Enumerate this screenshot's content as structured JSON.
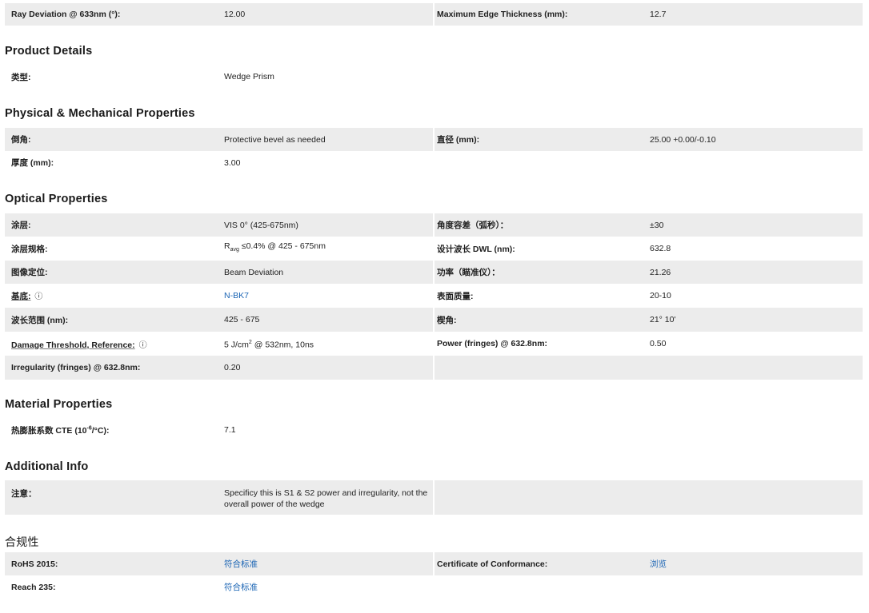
{
  "top_row": {
    "label1": "Ray Deviation @ 633nm (°):",
    "value1": "12.00",
    "label2": "Maximum Edge Thickness (mm):",
    "value2": "12.7"
  },
  "product_details": {
    "heading": "Product Details",
    "type_label": "类型:",
    "type_value": "Wedge Prism"
  },
  "physical": {
    "heading": "Physical & Mechanical Properties",
    "bevel_label": "倒角:",
    "bevel_value": "Protective bevel as needed",
    "diameter_label": "直径 (mm):",
    "diameter_value": "25.00 +0.00/-0.10",
    "thickness_label": "厚度 (mm):",
    "thickness_value": "3.00"
  },
  "optical": {
    "heading": "Optical Properties",
    "coating_label": "涂层:",
    "coating_value": "VIS 0° (425-675nm)",
    "angle_tol_label": "角度容差（弧秒）：",
    "angle_tol_value": "±30",
    "coating_spec_label": "涂层规格:",
    "coating_spec_r": "R",
    "coating_spec_sub": "avg",
    "coating_spec_rest": " ≤0.4% @ 425 - 675nm",
    "design_wl_label": "设计波长 DWL (nm):",
    "design_wl_value": "632.8",
    "image_label": "图像定位:",
    "image_value": "Beam Deviation",
    "power_label": "功率（瞄准仪）：",
    "power_value": "21.26",
    "substrate_label": "基底:",
    "substrate_icon": "ⓘ",
    "substrate_value": "N-BK7",
    "surface_label": "表面质量:",
    "surface_value": "20-10",
    "wavelength_label": "波长范围 (nm):",
    "wavelength_value": "425 - 675",
    "wedge_label": "楔角:",
    "wedge_value": "21° 10'",
    "damage_label": "Damage Threshold, Reference:",
    "damage_icon": "ⓘ",
    "damage_value_pre": "5 J/cm",
    "damage_value_sup": "2",
    "damage_value_post": " @ 532nm, 10ns",
    "power_fringes_label": "Power (fringes) @ 632.8nm:",
    "power_fringes_value": "0.50",
    "irregularity_label": "Irregularity (fringes) @ 632.8nm:",
    "irregularity_value": "0.20"
  },
  "material": {
    "heading": "Material Properties",
    "cte_label_pre": "热膨胀系数 CTE (10",
    "cte_label_sup": "-6",
    "cte_label_post": "/°C):",
    "cte_value": "7.1"
  },
  "additional": {
    "heading": "Additional Info",
    "note_label": "注意：",
    "note_line1": "Specificy this is S1 & S2 power and irregularity, not the",
    "note_line2": "overall power of the wedge"
  },
  "compliance": {
    "heading": "合规性",
    "rohs_label": "RoHS 2015:",
    "rohs_value": "符合标准",
    "coc_label": "Certificate of Conformance:",
    "coc_value": "浏览",
    "reach_label": "Reach 235:",
    "reach_value": "符合标准"
  },
  "colors": {
    "row_shade": "#ececec",
    "link": "#1a64b4",
    "text": "#1f1f1f"
  }
}
